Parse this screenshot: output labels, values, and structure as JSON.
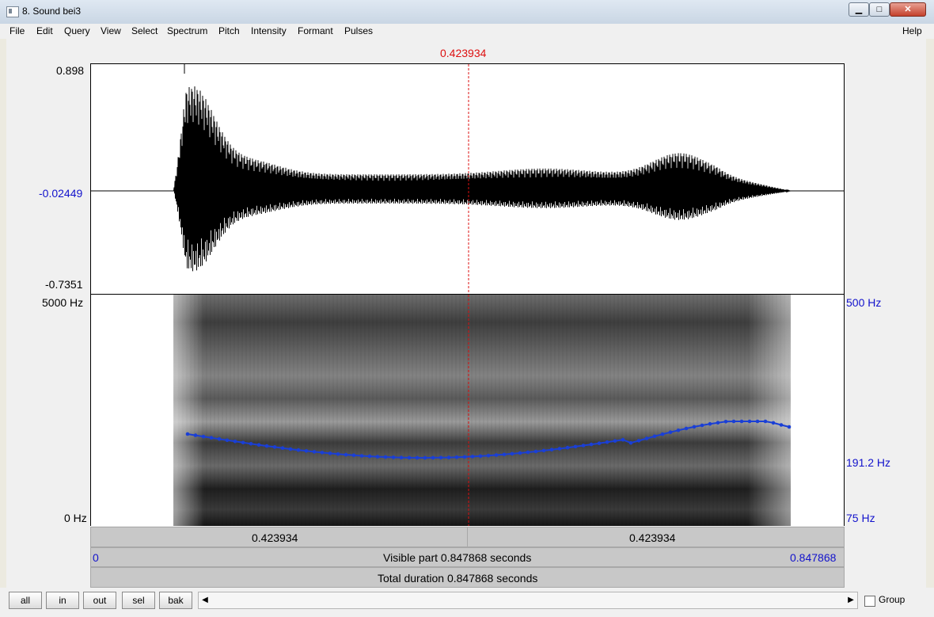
{
  "window": {
    "title": "8. Sound bei3"
  },
  "menu": [
    "File",
    "Edit",
    "Query",
    "View",
    "Select",
    "Spectrum",
    "Pitch",
    "Intensity",
    "Formant",
    "Pulses"
  ],
  "menu_help": "Help",
  "cursor_time": "0.423934",
  "waveform": {
    "max_label": "0.898",
    "mid_label": "-0.02449",
    "min_label": "-0.7351"
  },
  "spectrogram": {
    "top_freq": "5000 Hz",
    "bottom_freq": "0 Hz"
  },
  "pitch": {
    "top": "500 Hz",
    "current": "191.2 Hz",
    "bottom": "75 Hz"
  },
  "bars": {
    "left_segment": "0.423934",
    "right_segment": "0.423934",
    "visible_start": "0",
    "visible_text": "Visible part 0.847868 seconds",
    "visible_end": "0.847868",
    "total_text": "Total duration 0.847868 seconds"
  },
  "buttons": {
    "all": "all",
    "in": "in",
    "out": "out",
    "sel": "sel",
    "bak": "bak"
  },
  "group_label": "Group",
  "colors": {
    "cursor": "#dd1010",
    "pitch": "#1a3fd6",
    "axis_blue": "#1212cc"
  },
  "icons": {
    "scroll_left": "triangle-left",
    "scroll_right": "triangle-right"
  }
}
